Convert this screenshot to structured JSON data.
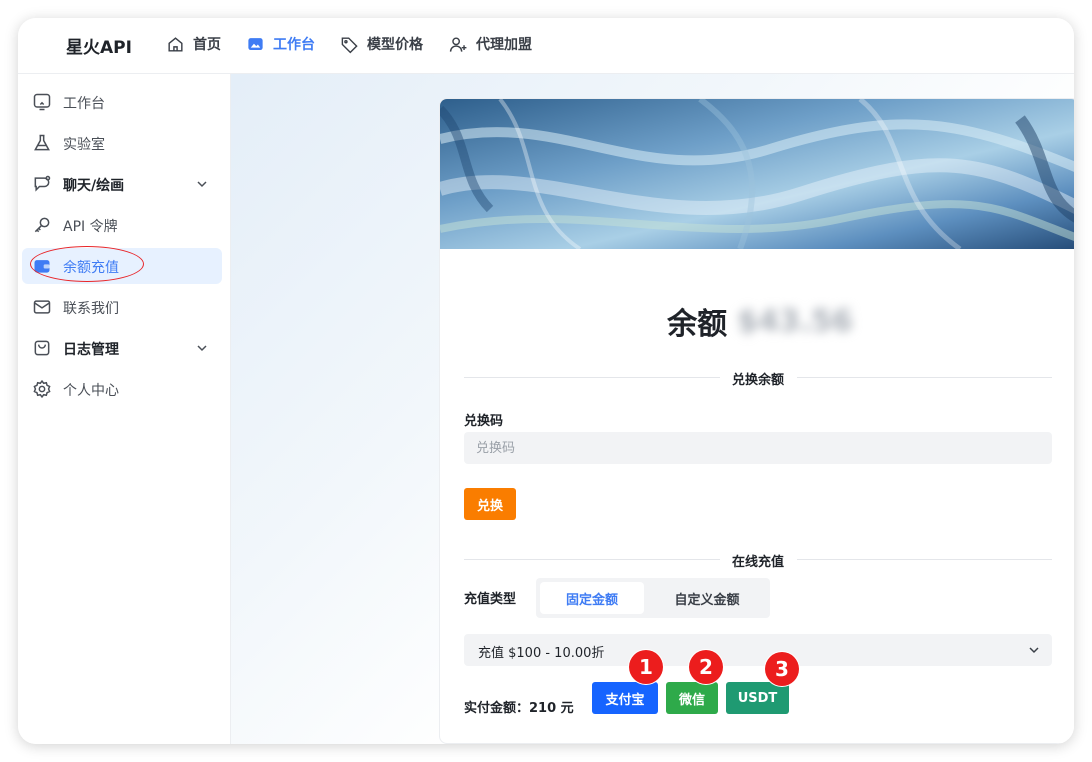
{
  "header": {
    "brand": "星火API",
    "nav": [
      {
        "label": "首页",
        "icon": "home-icon"
      },
      {
        "label": "工作台",
        "icon": "workbench-icon",
        "active": true
      },
      {
        "label": "模型价格",
        "icon": "tag-icon"
      },
      {
        "label": "代理加盟",
        "icon": "add-user-icon"
      }
    ]
  },
  "sidebar": {
    "items": [
      {
        "label": "工作台",
        "icon": "monitor-icon"
      },
      {
        "label": "实验室",
        "icon": "flask-icon"
      },
      {
        "label": "聊天/绘画",
        "icon": "chat-icon",
        "bold": true,
        "expandable": true
      },
      {
        "label": "API 令牌",
        "icon": "key-icon"
      },
      {
        "label": "余额充值",
        "icon": "wallet-icon",
        "active": true
      },
      {
        "label": "联系我们",
        "icon": "mail-icon"
      },
      {
        "label": "日志管理",
        "icon": "bag-icon",
        "bold": true,
        "expandable": true
      },
      {
        "label": "个人中心",
        "icon": "gear-icon"
      }
    ]
  },
  "card": {
    "balance_label": "余额",
    "balance_value": "$43.56",
    "redeem_section": "兑换余额",
    "code_label": "兑换码",
    "code_placeholder": "兑换码",
    "code_value": "",
    "redeem_button": "兑换",
    "online_section": "在线充值",
    "type_label": "充值类型",
    "type_options": [
      "固定金额",
      "自定义金额"
    ],
    "type_selected": "固定金额",
    "plan_selected": "充值 $100 - 10.00折",
    "pay_amount_label": "实付金额：210 元",
    "pay_buttons": {
      "alipay": "支付宝",
      "wechat": "微信",
      "usdt": "USDT"
    }
  },
  "annotations": {
    "badges": [
      "1",
      "2",
      "3"
    ]
  },
  "colors": {
    "accent": "#3f7cf4",
    "redeem": "#fa7d00",
    "alipay": "#1664ff",
    "wechat": "#2eaa4a",
    "usdt": "#1f9a72",
    "annotation": "#ec1d1d"
  }
}
